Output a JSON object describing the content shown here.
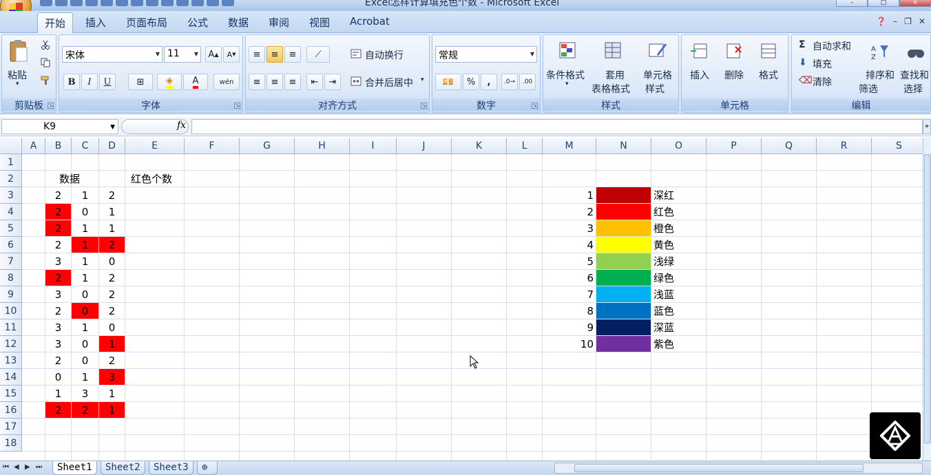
{
  "window": {
    "title": "Excel怎样计算填充色个数 - Microsoft Excel"
  },
  "tabs": [
    "开始",
    "插入",
    "页面布局",
    "公式",
    "数据",
    "审阅",
    "视图",
    "Acrobat"
  ],
  "ribbon": {
    "clipboard": {
      "paste": "粘贴",
      "name": "剪贴板"
    },
    "font": {
      "name_value": "宋体",
      "size_value": "11",
      "bold": "B",
      "italic": "I",
      "underline": "U",
      "group": "字体"
    },
    "alignment": {
      "wrap": "自动换行",
      "merge": "合并后居中",
      "group": "对齐方式"
    },
    "number": {
      "format_value": "常规",
      "percent": "%",
      "comma": ",",
      "group": "数字"
    },
    "styles": {
      "cond": "条件格式",
      "table1": "套用",
      "table2": "表格格式",
      "cell1": "单元格",
      "cell2": "样式",
      "group": "样式"
    },
    "cells": {
      "insert": "插入",
      "delete": "删除",
      "format": "格式",
      "group": "单元格"
    },
    "editing": {
      "autosum": "自动求和",
      "fill": "填充",
      "clear": "清除",
      "sort1": "排序和",
      "sort2": "筛选",
      "find1": "查找和",
      "find2": "选择",
      "group": "编辑"
    }
  },
  "formula_bar": {
    "name_box": "K9",
    "fx": "fx",
    "formula": ""
  },
  "columns": [
    "A",
    "B",
    "C",
    "D",
    "E",
    "F",
    "G",
    "H",
    "I",
    "J",
    "K",
    "L",
    "M",
    "N",
    "O",
    "P",
    "Q",
    "R",
    "S"
  ],
  "rows": [
    "1",
    "2",
    "3",
    "4",
    "5",
    "6",
    "7",
    "8",
    "9",
    "10",
    "11",
    "12",
    "13",
    "14",
    "15",
    "16",
    "17",
    "18"
  ],
  "header_data": "数据",
  "header_count": "红色个数",
  "table": [
    [
      {
        "v": "2",
        "red": false
      },
      {
        "v": "1",
        "red": false
      },
      {
        "v": "2",
        "red": false
      }
    ],
    [
      {
        "v": "2",
        "red": true
      },
      {
        "v": "0",
        "red": false
      },
      {
        "v": "1",
        "red": false
      }
    ],
    [
      {
        "v": "2",
        "red": true
      },
      {
        "v": "1",
        "red": false
      },
      {
        "v": "1",
        "red": false
      }
    ],
    [
      {
        "v": "2",
        "red": false
      },
      {
        "v": "1",
        "red": true
      },
      {
        "v": "2",
        "red": true
      }
    ],
    [
      {
        "v": "3",
        "red": false
      },
      {
        "v": "1",
        "red": false
      },
      {
        "v": "0",
        "red": false
      }
    ],
    [
      {
        "v": "2",
        "red": true
      },
      {
        "v": "1",
        "red": false
      },
      {
        "v": "2",
        "red": false
      }
    ],
    [
      {
        "v": "3",
        "red": false
      },
      {
        "v": "0",
        "red": false
      },
      {
        "v": "2",
        "red": false
      }
    ],
    [
      {
        "v": "2",
        "red": false
      },
      {
        "v": "0",
        "red": true
      },
      {
        "v": "2",
        "red": false
      }
    ],
    [
      {
        "v": "3",
        "red": false
      },
      {
        "v": "1",
        "red": false
      },
      {
        "v": "0",
        "red": false
      }
    ],
    [
      {
        "v": "3",
        "red": false
      },
      {
        "v": "0",
        "red": false
      },
      {
        "v": "1",
        "red": true
      }
    ],
    [
      {
        "v": "2",
        "red": false
      },
      {
        "v": "0",
        "red": false
      },
      {
        "v": "2",
        "red": false
      }
    ],
    [
      {
        "v": "0",
        "red": false
      },
      {
        "v": "1",
        "red": false
      },
      {
        "v": "3",
        "red": true
      }
    ],
    [
      {
        "v": "1",
        "red": false
      },
      {
        "v": "3",
        "red": false
      },
      {
        "v": "1",
        "red": false
      }
    ],
    [
      {
        "v": "2",
        "red": true
      },
      {
        "v": "2",
        "red": true
      },
      {
        "v": "1",
        "red": true
      }
    ]
  ],
  "fill_red": "#ff0000",
  "palette": [
    {
      "n": "1",
      "name": "深红",
      "color": "#c00000"
    },
    {
      "n": "2",
      "name": "红色",
      "color": "#ff0000"
    },
    {
      "n": "3",
      "name": "橙色",
      "color": "#ffc000"
    },
    {
      "n": "4",
      "name": "黄色",
      "color": "#ffff00"
    },
    {
      "n": "5",
      "name": "浅绿",
      "color": "#92d050"
    },
    {
      "n": "6",
      "name": "绿色",
      "color": "#00b050"
    },
    {
      "n": "7",
      "name": "浅蓝",
      "color": "#00b0f0"
    },
    {
      "n": "8",
      "name": "蓝色",
      "color": "#0070c0"
    },
    {
      "n": "9",
      "name": "深蓝",
      "color": "#002060"
    },
    {
      "n": "10",
      "name": "紫色",
      "color": "#7030a0"
    }
  ],
  "sheets": [
    "Sheet1",
    "Sheet2",
    "Sheet3"
  ]
}
